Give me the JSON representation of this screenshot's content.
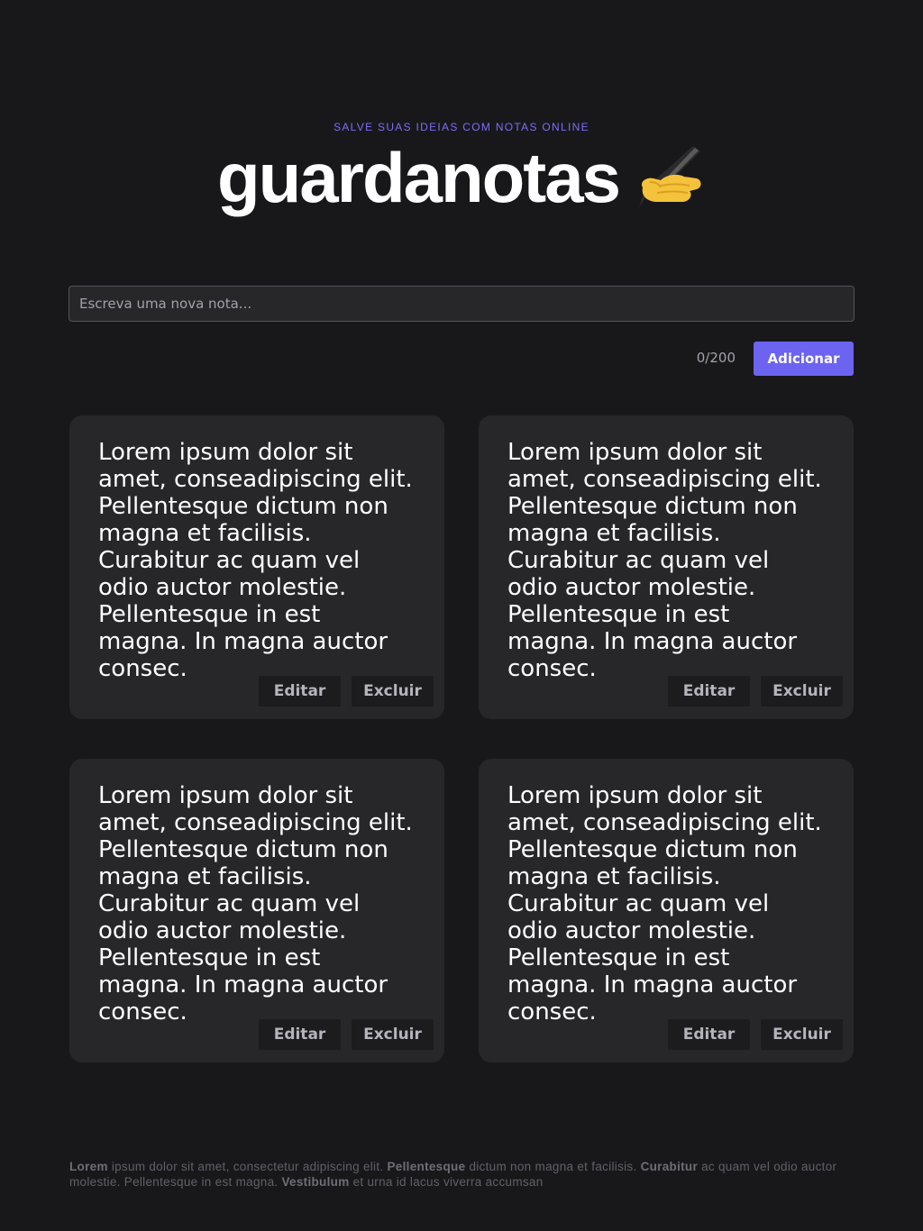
{
  "header": {
    "tagline": "SALVE SUAS IDEIAS COM NOTAS ONLINE",
    "title": "guardanotas",
    "title_icon": "writing-hand-icon"
  },
  "composer": {
    "placeholder": "Escreva uma nova nota...",
    "value": "",
    "counter": "0/200",
    "add_label": "Adicionar"
  },
  "colors": {
    "background": "#18181b",
    "card": "#27272a",
    "accent": "#6c63f0"
  },
  "notes": [
    {
      "text": "Lorem ipsum dolor sit amet, conseadipiscing elit. Pellentesque dictum non magna et facilisis. Curabitur ac quam vel odio auctor molestie. Pellentesque in est magna. In magna auctor consec.",
      "edit_label": "Editar",
      "delete_label": "Excluir"
    },
    {
      "text": "Lorem ipsum dolor sit amet, conseadipiscing elit. Pellentesque dictum non magna et facilisis. Curabitur ac quam vel odio auctor molestie. Pellentesque in est magna. In magna auctor consec.",
      "edit_label": "Editar",
      "delete_label": "Excluir"
    },
    {
      "text": "Lorem ipsum dolor sit amet, conseadipiscing elit. Pellentesque dictum non magna et facilisis. Curabitur ac quam vel odio auctor molestie. Pellentesque in est magna. In magna auctor consec.",
      "edit_label": "Editar",
      "delete_label": "Excluir"
    },
    {
      "text": "Lorem ipsum dolor sit amet, conseadipiscing elit. Pellentesque dictum non magna et facilisis. Curabitur ac quam vel odio auctor molestie. Pellentesque in est magna. In magna auctor consec.",
      "edit_label": "Editar",
      "delete_label": "Excluir"
    }
  ],
  "footer": {
    "segments": [
      {
        "text": "Lorem",
        "bold": true
      },
      {
        "text": " ipsum dolor sit amet, consectetur adipiscing elit. ",
        "bold": false
      },
      {
        "text": "Pellentesque",
        "bold": true
      },
      {
        "text": " dictum non magna et facilisis. ",
        "bold": false
      },
      {
        "text": "Curabitur",
        "bold": true
      },
      {
        "text": " ac quam vel odio auctor molestie. Pellentesque in est magna. ",
        "bold": false
      },
      {
        "text": "Vestibulum",
        "bold": true
      },
      {
        "text": " et urna id lacus viverra accumsan",
        "bold": false
      }
    ]
  }
}
